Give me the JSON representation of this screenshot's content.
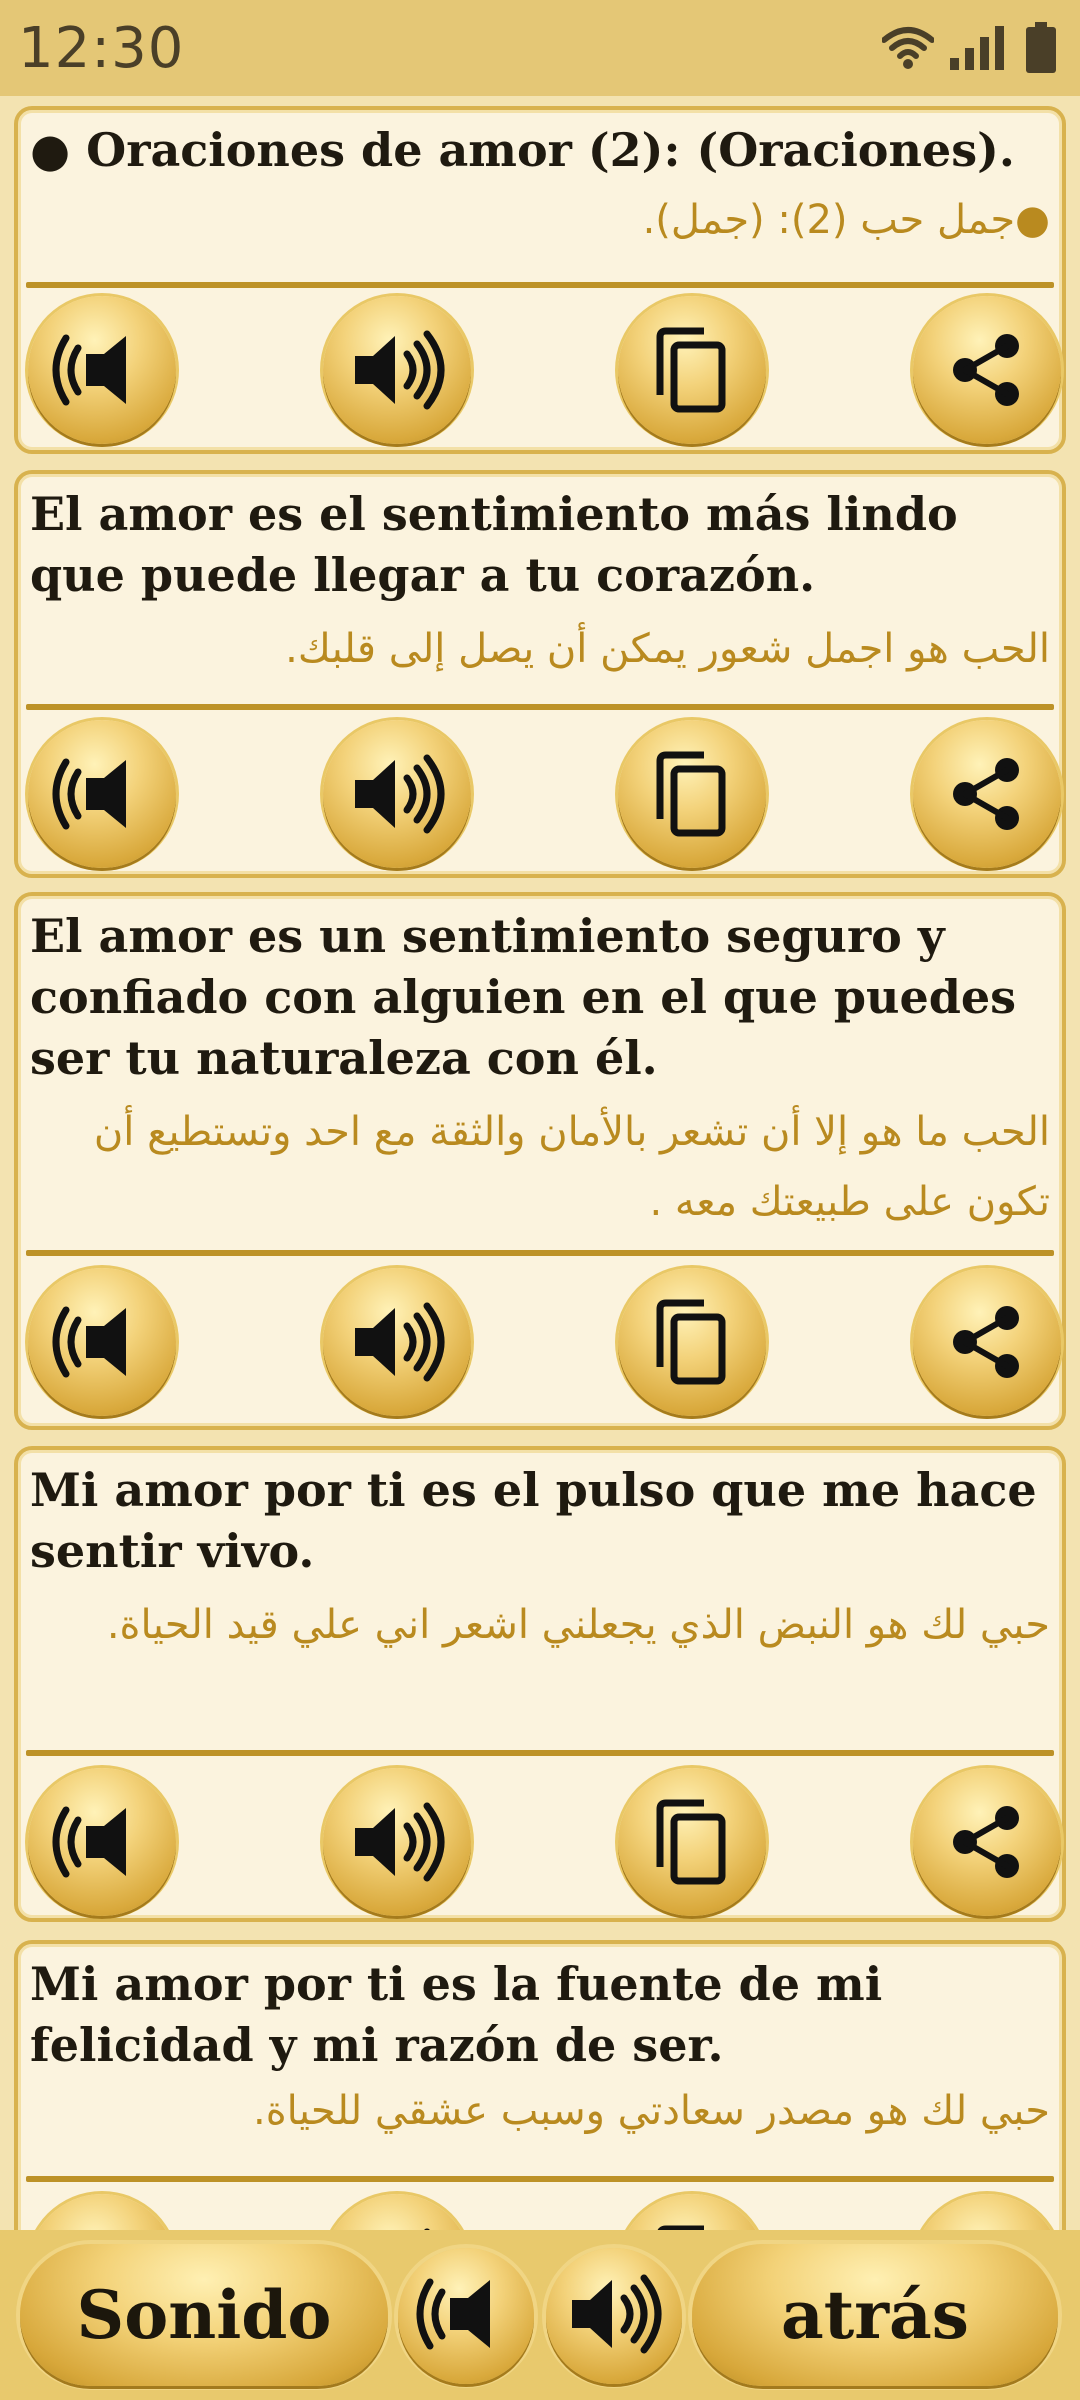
{
  "status_bar": {
    "time": "12:30",
    "icons": [
      "wifi-icon",
      "signal-icon",
      "battery-icon"
    ]
  },
  "cards": [
    {
      "spanish": "● Oraciones de amor (2): (Oraciones).",
      "arabic": "●جمل حب (2): (جمل).",
      "buttons": [
        "slow-audio-icon",
        "audio-icon",
        "copy-icon",
        "share-icon"
      ]
    },
    {
      "spanish": "El amor es el sentimiento más lindo que puede llegar a tu corazón.",
      "arabic": "الحب هو اجمل شعور يمكن أن يصل إلى قلبك.",
      "buttons": [
        "slow-audio-icon",
        "audio-icon",
        "copy-icon",
        "share-icon"
      ]
    },
    {
      "spanish": "El amor es un sentimiento seguro y confiado con alguien en el que puedes ser tu naturaleza con él.",
      "arabic": "الحب ما هو  إلا أن تشعر بالأمان والثقة مع احد وتستطيع أن تكون على طبيعتك معه .",
      "buttons": [
        "slow-audio-icon",
        "audio-icon",
        "copy-icon",
        "share-icon"
      ]
    },
    {
      "spanish": "Mi amor por ti es el pulso que me hace sentir vivo.",
      "arabic": "حبي لك هو النبض الذي يجعلني اشعر اني علي قيد الحياة.",
      "buttons": [
        "slow-audio-icon",
        "audio-icon",
        "copy-icon",
        "share-icon"
      ]
    },
    {
      "spanish": "Mi amor por ti es la fuente de mi felicidad y mi razón de ser.",
      "arabic": "حبي لك هو مصدر سعادتي وسبب عشقي للحياة.",
      "buttons": [
        "slow-audio-icon",
        "audio-icon",
        "copy-icon",
        "share-icon"
      ]
    }
  ],
  "bottom_bar": {
    "sound_label": "Sonido",
    "back_label": "atrás"
  },
  "colors": {
    "accent_gold": "#d8b24e",
    "arabic_text": "#b98a1f",
    "card_bg": "#fbf3de"
  }
}
